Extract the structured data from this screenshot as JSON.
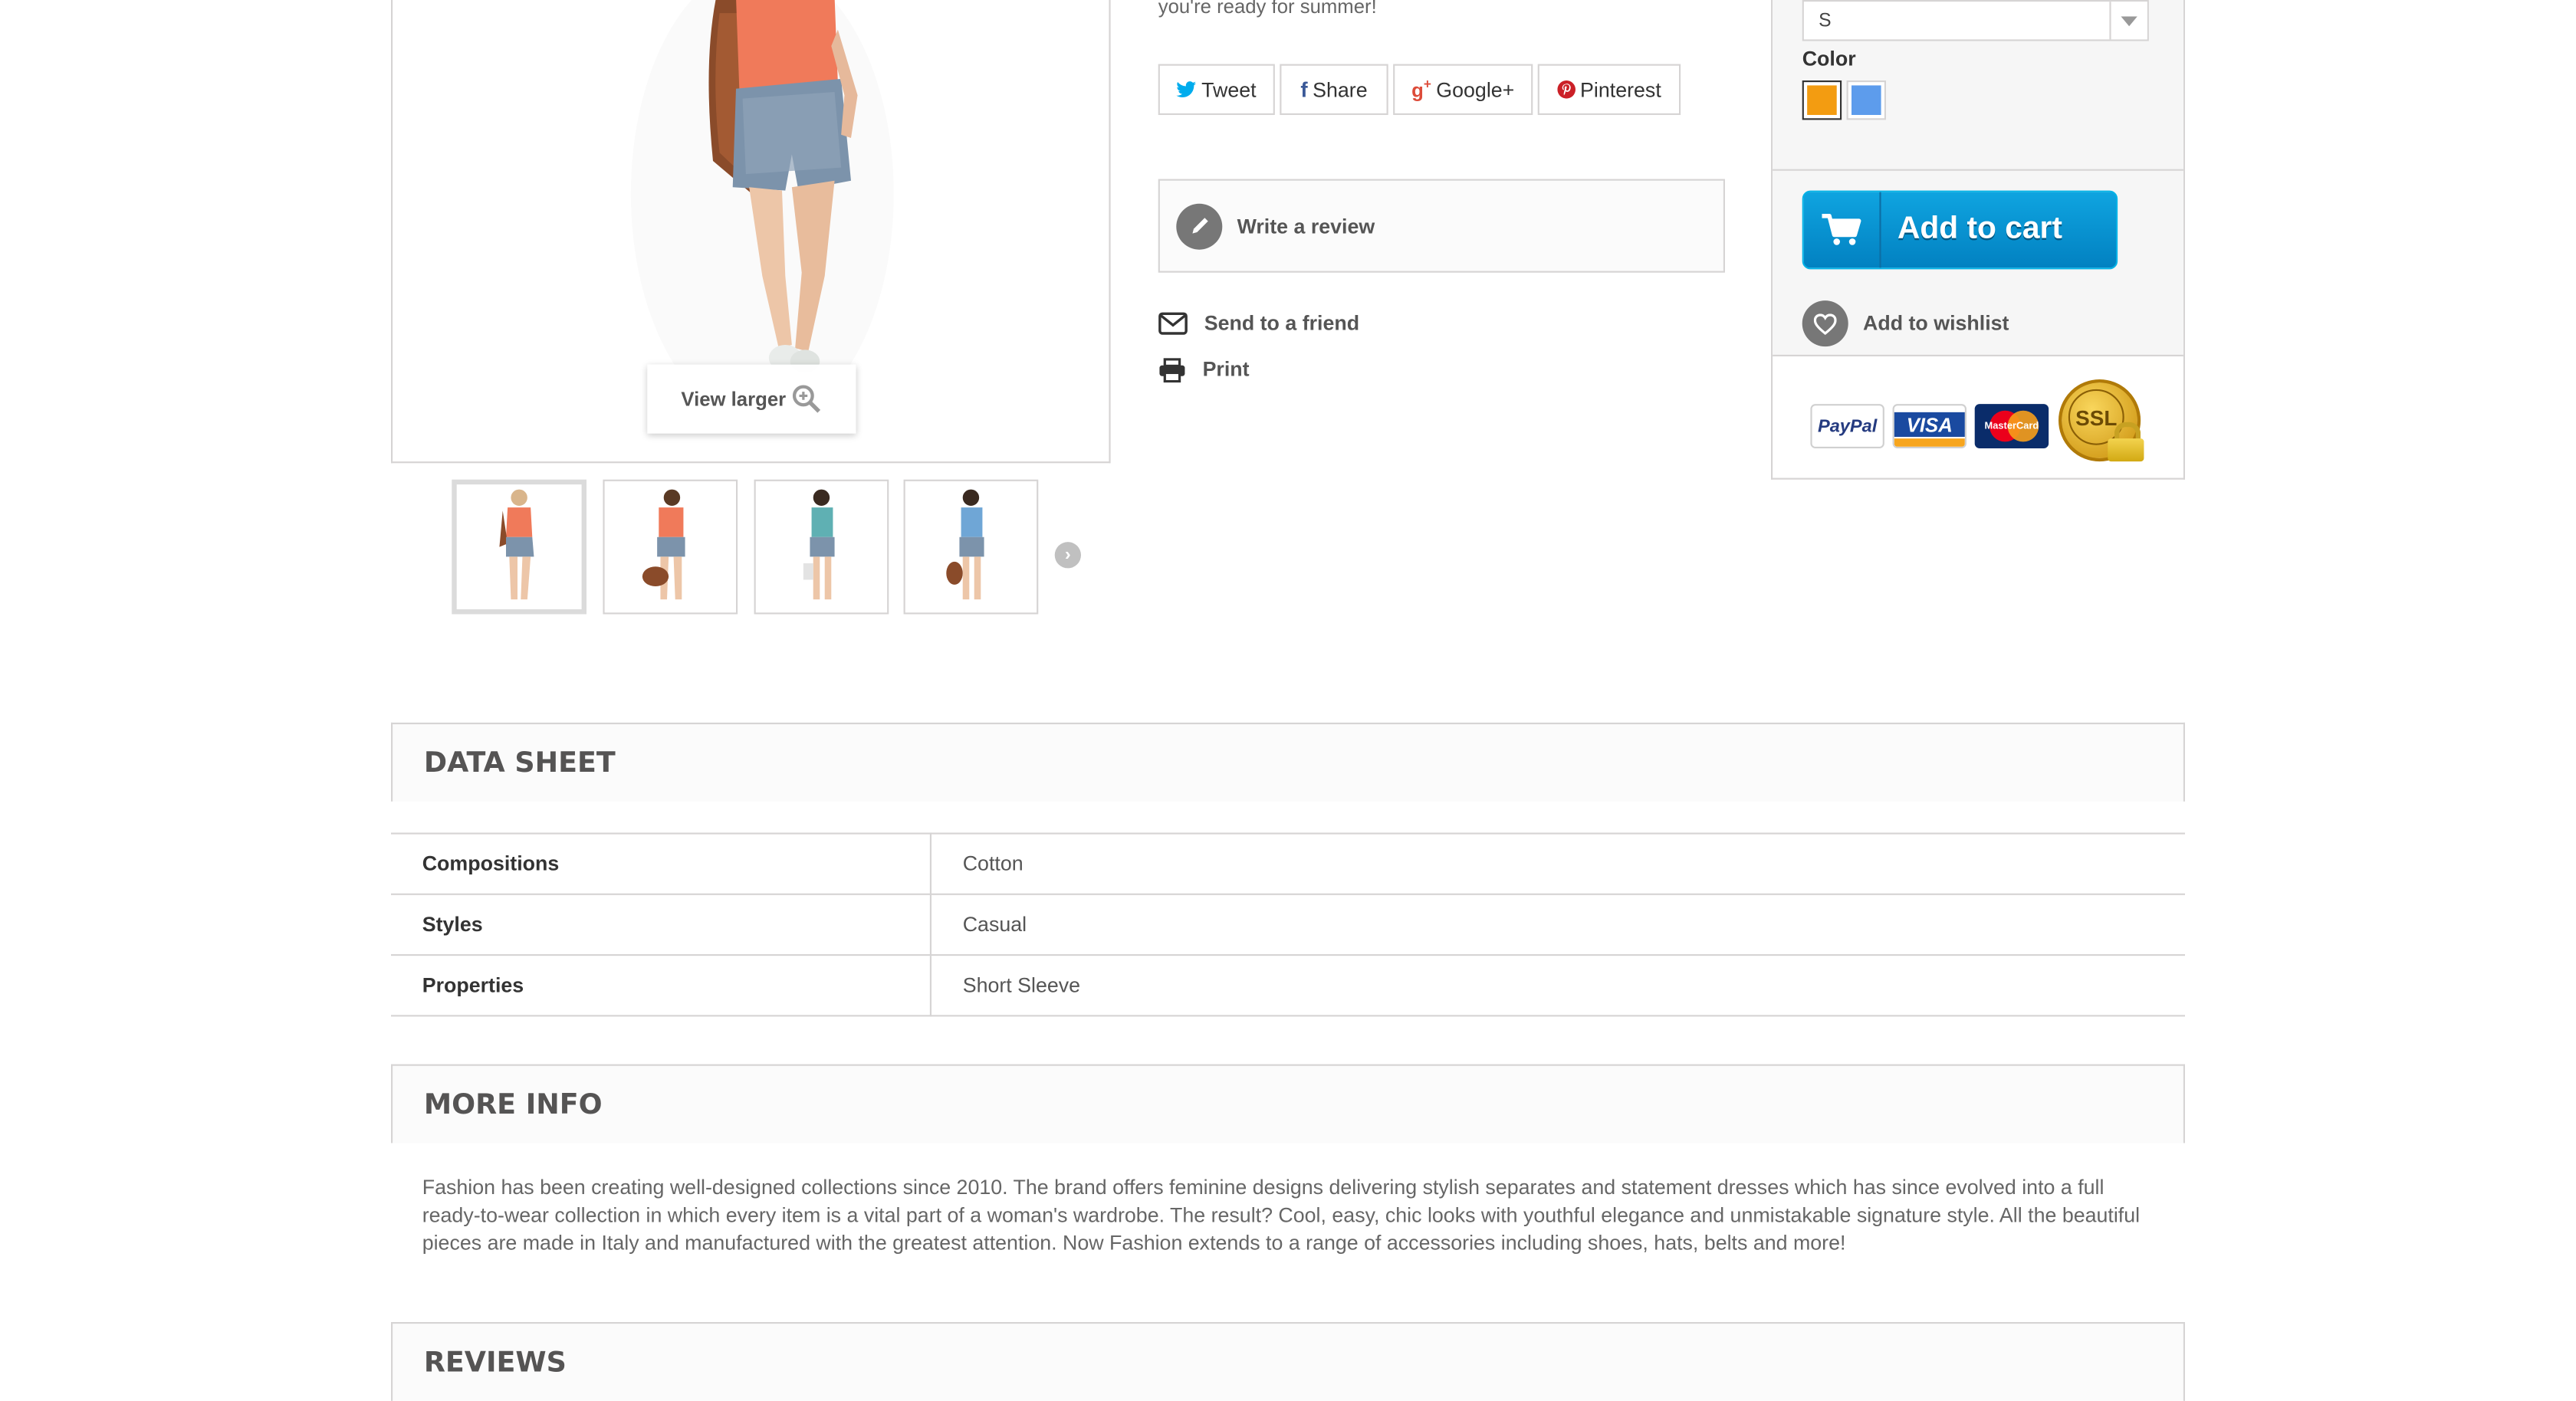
{
  "product_media": {
    "view_larger_label": "View larger",
    "thumbnails": [
      {
        "alt": "thumbnail-1"
      },
      {
        "alt": "thumbnail-2"
      },
      {
        "alt": "thumbnail-3"
      },
      {
        "alt": "thumbnail-4"
      }
    ],
    "thumbnail_next_icon": "chevron-right-icon"
  },
  "description_tail": "you're ready for summer!",
  "social": {
    "tweet_label": "Tweet",
    "share_label": "Share",
    "google_label": "Google+",
    "pinterest_label": "Pinterest"
  },
  "actions": {
    "write_review_label": "Write a review",
    "send_to_friend_label": "Send to a friend",
    "print_label": "Print"
  },
  "buy_box": {
    "size_value": "S",
    "color_label": "Color",
    "colors": [
      {
        "name": "Orange",
        "hex": "#f39c11",
        "selected": true
      },
      {
        "name": "Blue",
        "hex": "#5d9cec",
        "selected": false
      }
    ],
    "add_to_cart_label": "Add to cart",
    "add_to_wishlist_label": "Add to wishlist",
    "payment_logos": [
      "PayPal",
      "VISA",
      "MasterCard",
      "SSL"
    ]
  },
  "data_sheet": {
    "title": "DATA SHEET",
    "rows": [
      {
        "key": "Compositions",
        "value": "Cotton"
      },
      {
        "key": "Styles",
        "value": "Casual"
      },
      {
        "key": "Properties",
        "value": "Short Sleeve"
      }
    ]
  },
  "more_info": {
    "title": "MORE INFO",
    "text": "Fashion has been creating well-designed collections since 2010. The brand offers feminine designs delivering stylish separates and statement dresses which has since evolved into a full ready-to-wear collection in which every item is a vital part of a woman's wardrobe. The result? Cool, easy, chic looks with youthful elegance and unmistakable signature style. All the beautiful pieces are made in Italy and manufactured with the greatest attention. Now Fashion extends to a range of accessories including shoes, hats, belts and more!"
  },
  "reviews": {
    "title": "REVIEWS"
  },
  "colors": {
    "accent_blue": "#0281c1",
    "border": "#d6d4d4",
    "icon_gray": "#777777"
  }
}
